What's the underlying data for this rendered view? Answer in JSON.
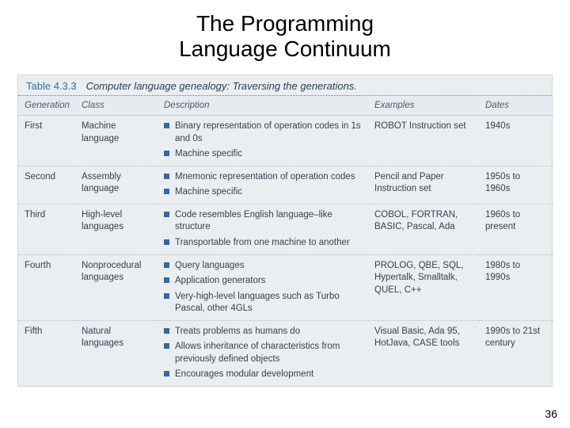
{
  "title": {
    "line1": "The Programming",
    "line2": "Language Continuum"
  },
  "table": {
    "number": "Table 4.3.3",
    "caption": "Computer language genealogy: Traversing the generations.",
    "headers": {
      "generation": "Generation",
      "class": "Class",
      "description": "Description",
      "examples": "Examples",
      "dates": "Dates"
    },
    "rows": [
      {
        "generation": "First",
        "class": "Machine language",
        "desc": [
          "Binary representation of operation codes in 1s and 0s",
          "Machine specific"
        ],
        "examples": "ROBOT Instruction set",
        "dates": "1940s"
      },
      {
        "generation": "Second",
        "class": "Assembly language",
        "desc": [
          "Mnemonic representation of operation codes",
          "Machine specific"
        ],
        "examples": "Pencil and Paper Instruction set",
        "dates": "1950s to 1960s"
      },
      {
        "generation": "Third",
        "class": "High-level languages",
        "desc": [
          "Code resembles English language–like structure",
          "Transportable from one machine to another"
        ],
        "examples": "COBOL, FORTRAN, BASIC, Pascal, Ada",
        "dates": "1960s to present"
      },
      {
        "generation": "Fourth",
        "class": "Nonprocedural languages",
        "desc": [
          "Query languages",
          "Application generators",
          "Very-high-level languages such as Turbo Pascal, other 4GLs"
        ],
        "examples": "PROLOG, QBE, SQL, Hypertalk, Smalltalk, QUEL, C++",
        "dates": "1980s to 1990s"
      },
      {
        "generation": "Fifth",
        "class": "Natural languages",
        "desc": [
          "Treats problems as humans do",
          "Allows inheritance of characteristics from previously defined objects",
          "Encourages modular development"
        ],
        "examples": "Visual Basic, Ada 95, HotJava, CASE tools",
        "dates": "1990s to 21st century"
      }
    ]
  },
  "pageNumber": "36"
}
